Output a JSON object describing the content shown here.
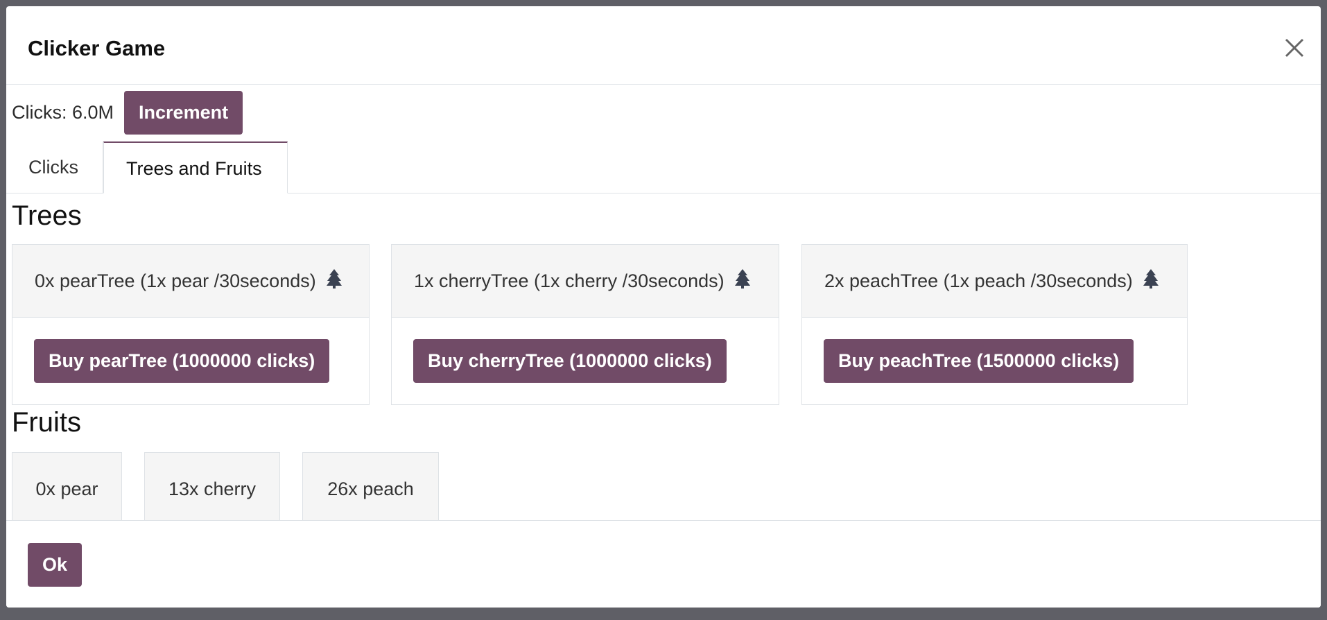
{
  "modal": {
    "title": "Clicker Game",
    "close_icon": "close-icon"
  },
  "counter": {
    "label": "Clicks: 6.0M",
    "increment_label": "Increment"
  },
  "tabs": [
    {
      "label": "Clicks",
      "active": false
    },
    {
      "label": "Trees and Fruits",
      "active": true
    }
  ],
  "trees": {
    "heading": "Trees",
    "items": [
      {
        "label": "0x pearTree (1x pear /30seconds)",
        "icon": "tree-icon",
        "buy_label": "Buy pearTree (1000000 clicks)"
      },
      {
        "label": "1x cherryTree (1x cherry /30seconds)",
        "icon": "tree-icon",
        "buy_label": "Buy cherryTree (1000000 clicks)"
      },
      {
        "label": "2x peachTree (1x peach /30seconds)",
        "icon": "tree-icon",
        "buy_label": "Buy peachTree (1500000 clicks)"
      }
    ]
  },
  "fruits": {
    "heading": "Fruits",
    "items": [
      {
        "label": "0x pear"
      },
      {
        "label": "13x cherry"
      },
      {
        "label": "26x peach"
      }
    ]
  },
  "footer": {
    "ok_label": "Ok"
  },
  "colors": {
    "accent": "#714b67",
    "backdrop": "#5f5f66",
    "card_header": "#f5f5f5",
    "border": "#dee2e6"
  }
}
